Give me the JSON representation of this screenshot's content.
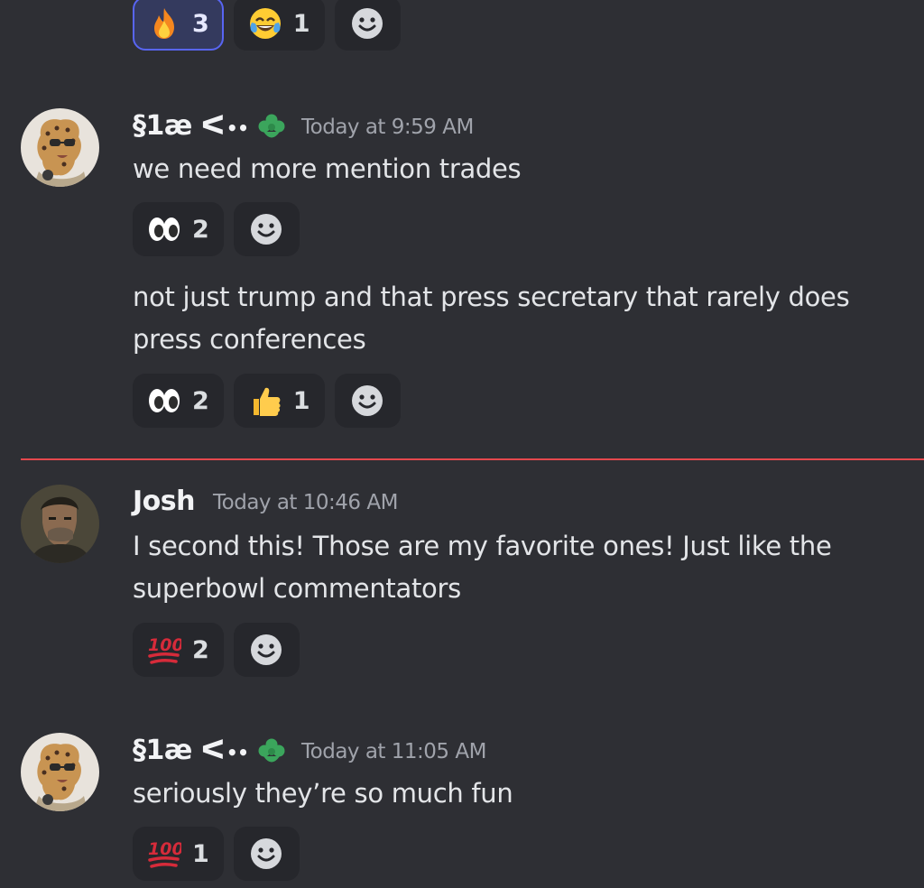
{
  "messages": [
    {
      "id": "m1",
      "continuation": true,
      "reactions": [
        {
          "emoji": "fire-emoji",
          "count": "3",
          "active": true
        },
        {
          "emoji": "joy-emoji",
          "count": "1",
          "active": false
        },
        {
          "emoji": "add-reaction-icon",
          "count": null,
          "active": false
        }
      ]
    },
    {
      "id": "m2",
      "username": "§1æ ᐸ",
      "username_suffix": "••",
      "role_icon": "green-flower-role-icon",
      "timestamp": "Today at 9:59 AM",
      "text": "we need more mention trades",
      "reactions": [
        {
          "emoji": "eyes-emoji",
          "count": "2"
        },
        {
          "emoji": "add-reaction-icon",
          "count": null
        }
      ]
    },
    {
      "id": "m3",
      "continuation": true,
      "text": "not just trump and that press secretary that rarely does press conferences",
      "reactions": [
        {
          "emoji": "eyes-emoji",
          "count": "2"
        },
        {
          "emoji": "thumbs-up-emoji",
          "count": "1"
        },
        {
          "emoji": "add-reaction-icon",
          "count": null
        }
      ]
    },
    {
      "id": "m4",
      "username": "Josh",
      "timestamp": "Today at 10:46 AM",
      "text": "I second this! Those are my favorite ones! Just like the superbowl commentators",
      "reactions": [
        {
          "emoji": "hundred-emoji",
          "count": "2"
        },
        {
          "emoji": "add-reaction-icon",
          "count": null
        }
      ]
    },
    {
      "id": "m5",
      "username": "§1æ ᐸ",
      "username_suffix": "••",
      "role_icon": "green-flower-role-icon",
      "timestamp": "Today at 11:05 AM",
      "text": "seriously they’re so much fun",
      "reactions": [
        {
          "emoji": "hundred-emoji",
          "count": "1"
        },
        {
          "emoji": "add-reaction-icon",
          "count": null
        }
      ]
    }
  ],
  "divider_color": "#e5484d",
  "accent_color": "#5865f2",
  "role_color": "#3ba55c"
}
